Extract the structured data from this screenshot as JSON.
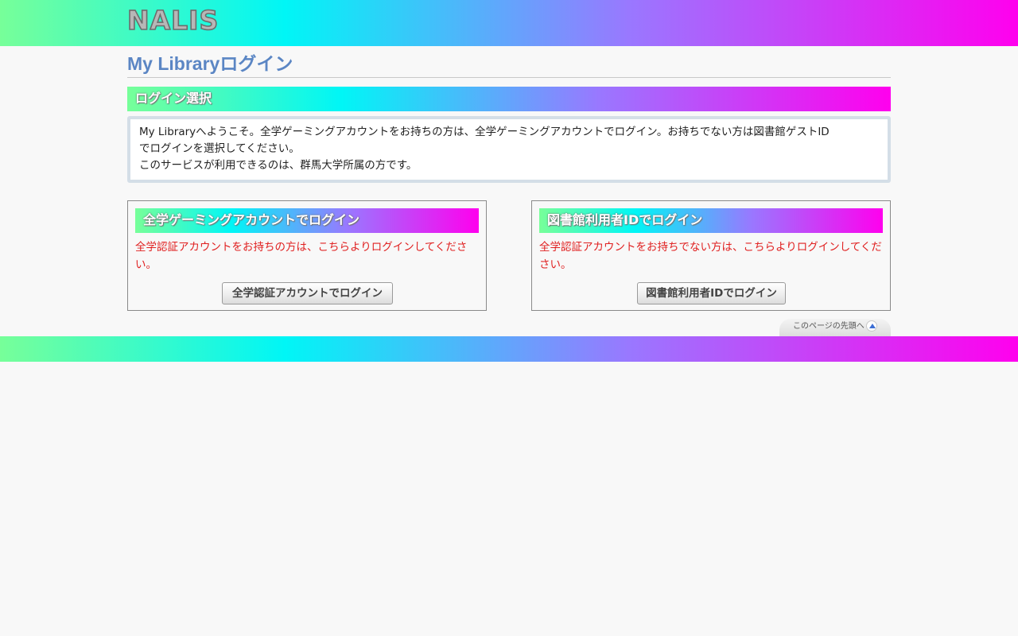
{
  "header": {
    "logo_text": "NALIS"
  },
  "page": {
    "title": "My Libraryログイン"
  },
  "section": {
    "title": "ログイン選択"
  },
  "notice": {
    "line1": "My Libraryへようこそ。全学ゲーミングアカウントをお持ちの方は、全学ゲーミングアカウントでログイン。お持ちでない方は図書館ゲストID",
    "line2": "でログインを選択してください。",
    "line3": "このサービスが利用できるのは、群馬大学所属の方です。"
  },
  "left_box": {
    "heading": "全学ゲーミングアカウントでログイン",
    "description": "全学認証アカウントをお持ちの方は、こちらよりログインしてください。",
    "button_label": "全学認証アカウントでログイン"
  },
  "right_box": {
    "heading": "図書館利用者IDでログイン",
    "description": "全学認証アカウントをお持ちでない方は、こちらよりログインしてください。",
    "button_label": "図書館利用者IDでログイン"
  },
  "footer": {
    "page_top_label": "このページの先頭へ",
    "page_top_icon": "arrow-up-icon"
  },
  "colors": {
    "gradient_start": "#77ff99",
    "gradient_mid": "#00f6f6",
    "gradient_end": "#ff00ee",
    "title_blue": "#5b86c4",
    "description_red": "#e02020"
  }
}
